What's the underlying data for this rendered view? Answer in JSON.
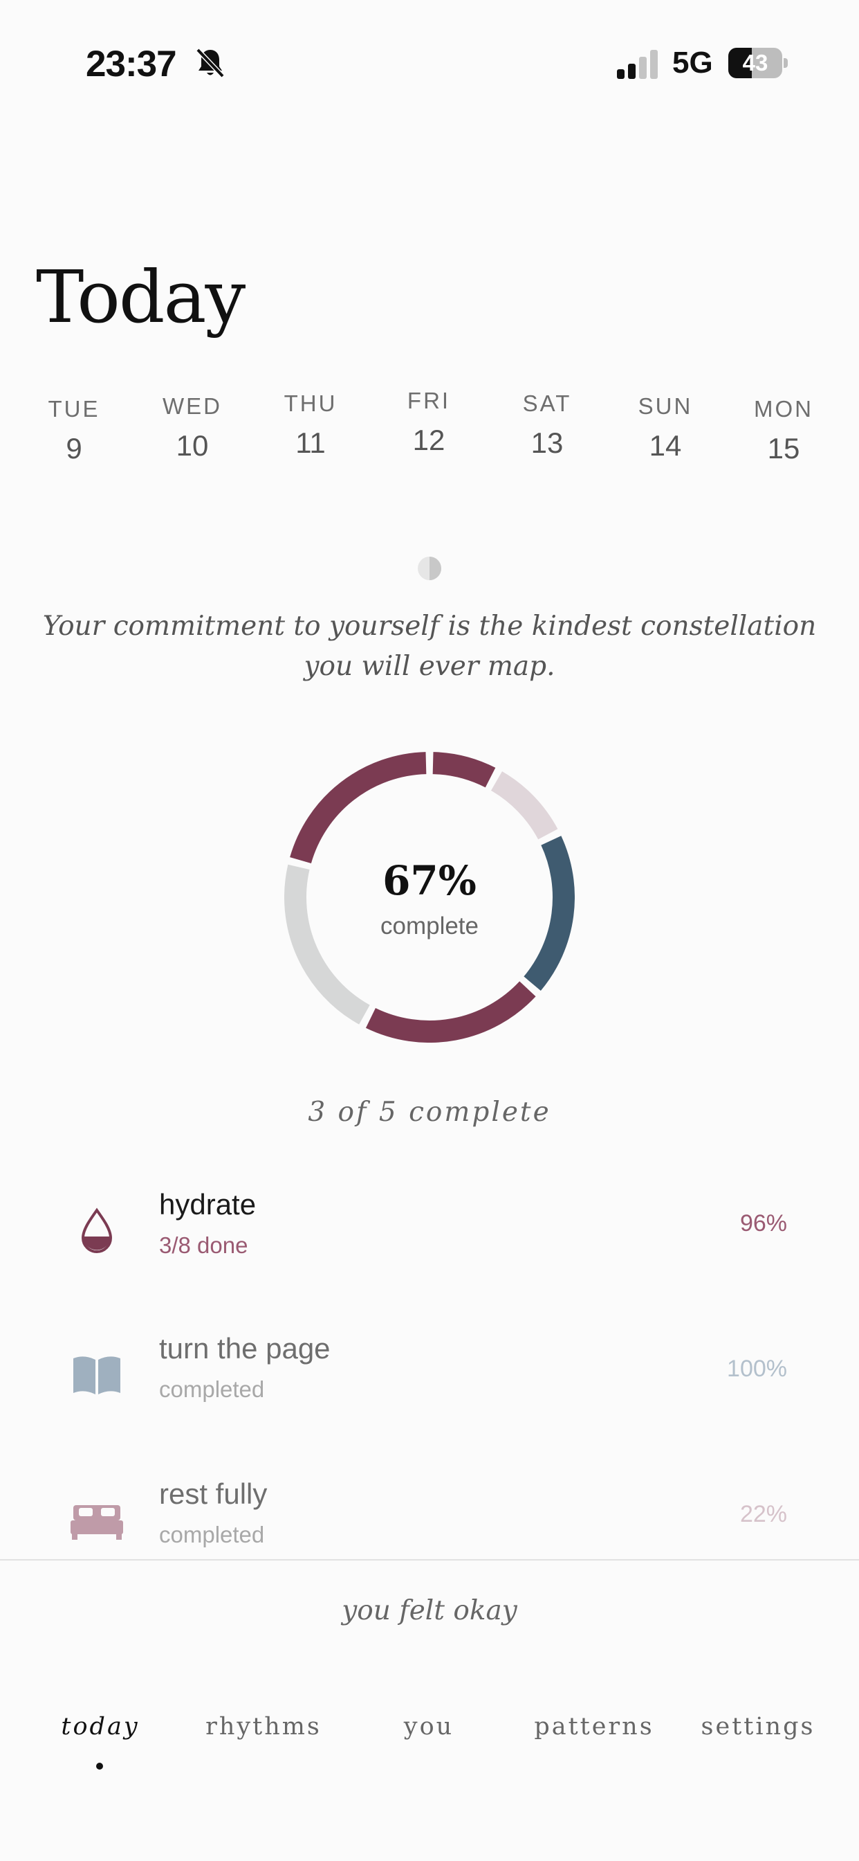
{
  "status_bar": {
    "time": "23:37",
    "network": "5G",
    "battery": "43",
    "battery_level_percent": 43,
    "icons": [
      "bell-slash-icon",
      "cellular-signal-icon",
      "battery-icon"
    ]
  },
  "header": {
    "title": "Today"
  },
  "week": [
    {
      "day": "TUE",
      "date": "9"
    },
    {
      "day": "WED",
      "date": "10"
    },
    {
      "day": "THU",
      "date": "11"
    },
    {
      "day": "FRI",
      "date": "12"
    },
    {
      "day": "SAT",
      "date": "13"
    },
    {
      "day": "SUN",
      "date": "14"
    },
    {
      "day": "MON",
      "date": "15"
    }
  ],
  "moon_icon": "half-moon-icon",
  "quote": "Your commitment to yourself is the kindest constellation you will ever map.",
  "progress": {
    "percent": "67%",
    "label": "complete",
    "summary": "3 of 5 complete"
  },
  "colors": {
    "wine": "#7b3b52",
    "slate_blue": "#3f5b70",
    "light_mauve": "#e0d6da",
    "light_gray": "#d6d7d7",
    "muted_blue": "#9fb0bf",
    "dusty_pink": "#bf9ba8"
  },
  "habits": [
    {
      "name": "hydrate",
      "status": "3/8 done",
      "percent": "96%",
      "icon": "water-drop-icon"
    },
    {
      "name": "turn the page",
      "status": "completed",
      "percent": "100%",
      "icon": "book-icon"
    },
    {
      "name": "rest fully",
      "status": "completed",
      "percent": "22%",
      "icon": "bed-icon"
    }
  ],
  "mood": {
    "text": "you felt okay"
  },
  "tabs": [
    {
      "label": "today",
      "active": true
    },
    {
      "label": "rhythms",
      "active": false
    },
    {
      "label": "you",
      "active": false
    },
    {
      "label": "patterns",
      "active": false
    },
    {
      "label": "settings",
      "active": false
    }
  ]
}
